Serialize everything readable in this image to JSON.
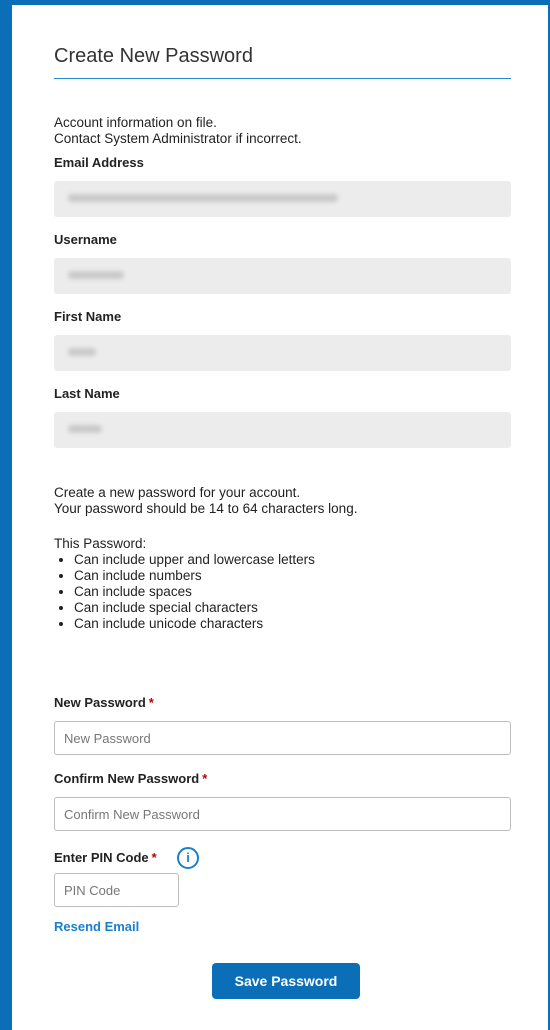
{
  "title": "Create New Password",
  "intro": {
    "line1": "Account information on file.",
    "line2": "Contact System Administrator if incorrect."
  },
  "account_fields": [
    {
      "label": "Email Address"
    },
    {
      "label": "Username"
    },
    {
      "label": "First Name"
    },
    {
      "label": "Last Name"
    }
  ],
  "help": {
    "line1": "Create a new password for your account.",
    "line2": "Your password should be 14 to 64 characters long."
  },
  "rules": {
    "heading": "This Password:",
    "items": [
      "Can include upper and lowercase letters",
      "Can include numbers",
      "Can include spaces",
      "Can include special characters",
      "Can include unicode characters"
    ]
  },
  "form": {
    "required_marker": "*",
    "new_password": {
      "label": "New Password",
      "placeholder": "New Password"
    },
    "confirm_password": {
      "label": "Confirm New Password",
      "placeholder": "Confirm New Password"
    },
    "pin": {
      "label": "Enter PIN Code",
      "placeholder": "PIN Code",
      "info_icon": "i"
    }
  },
  "resend_link": "Resend Email",
  "save_button": "Save Password",
  "colors": {
    "accent": "#0b6fb8",
    "link": "#1a7fd0",
    "required": "#c00000",
    "readonly_bg": "#ececec"
  }
}
